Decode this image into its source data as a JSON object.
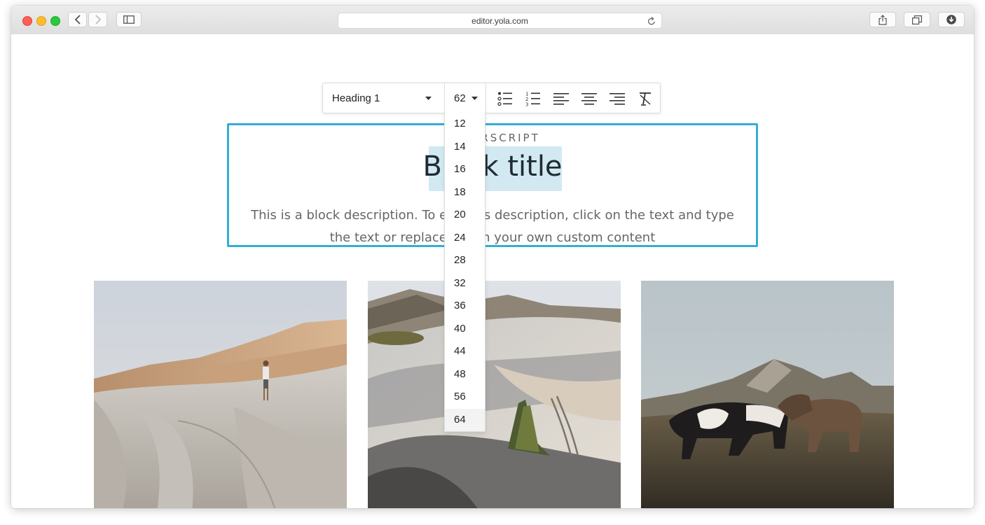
{
  "browser": {
    "url": "editor.yola.com",
    "icons": [
      "back-icon",
      "forward-icon",
      "sidebar-icon",
      "reload-icon",
      "share-icon",
      "tabs-icon",
      "download-icon"
    ]
  },
  "toolbar": {
    "style_value": "Heading 1",
    "size_value": "62",
    "icons": [
      "bullet-list-icon",
      "numbered-list-icon",
      "align-left-icon",
      "align-center-icon",
      "align-right-icon",
      "clear-format-icon"
    ]
  },
  "size_dropdown": {
    "options": [
      "12",
      "14",
      "16",
      "18",
      "20",
      "24",
      "28",
      "32",
      "36",
      "40",
      "44",
      "48",
      "56",
      "64"
    ],
    "highlighted": "64"
  },
  "block": {
    "superscript": "SUPERSCRIPT",
    "title": "Block title",
    "description": "This is a block description. To edit this description, click on the text and type the text or replace it with your own custom content"
  },
  "photos": [
    {
      "subject": "desert-rocks-person-photo"
    },
    {
      "subject": "sand-dunes-tree-photo"
    },
    {
      "subject": "horses-mountain-photo"
    }
  ],
  "colors": {
    "selection_border": "#33aed6",
    "title_highlight": "#d2e9f2",
    "title_text": "#1f2b33"
  }
}
